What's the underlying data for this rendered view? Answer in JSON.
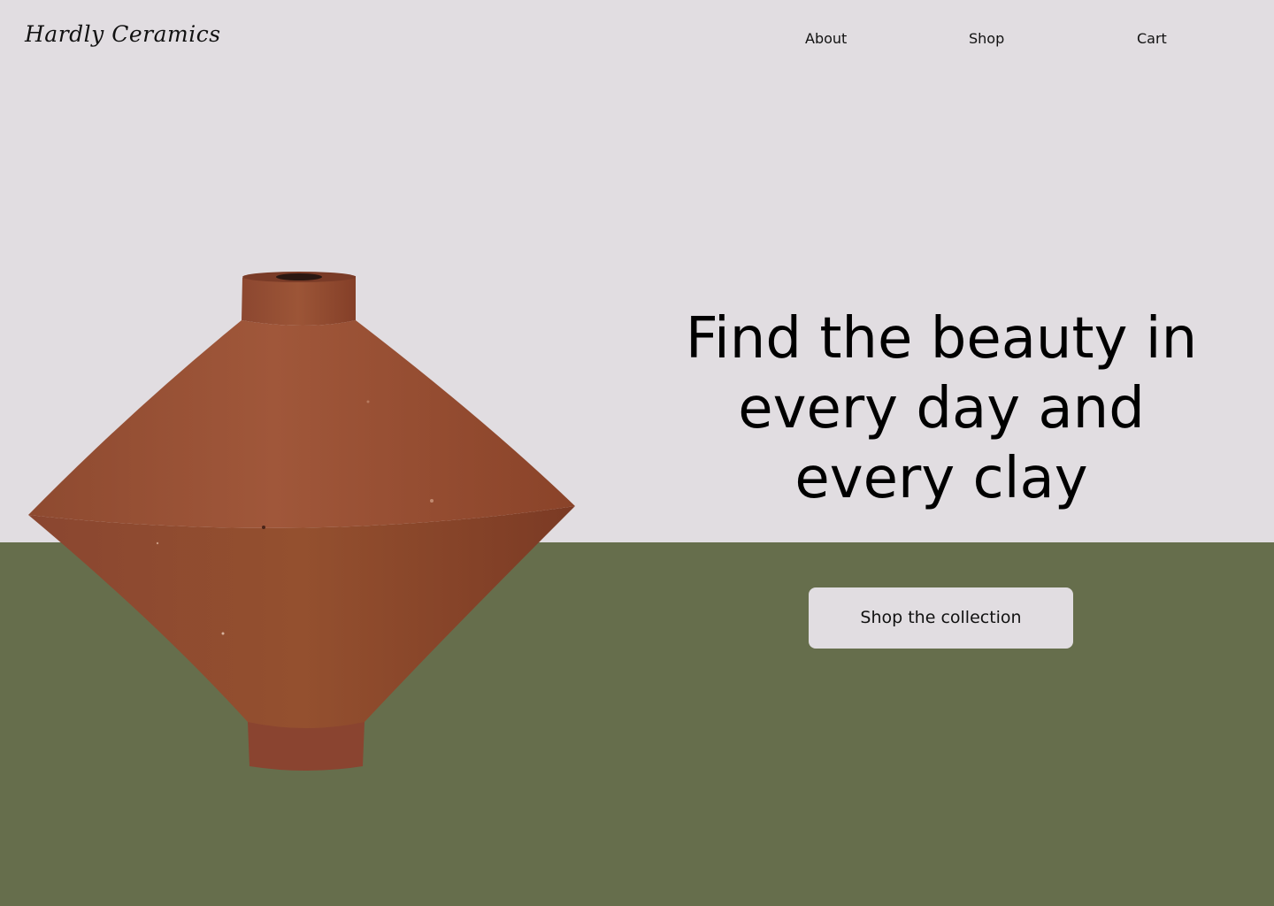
{
  "brand": {
    "logo_text": "Hardly Ceramics"
  },
  "nav": {
    "items": [
      {
        "label": "About"
      },
      {
        "label": "Shop"
      },
      {
        "label": "Cart"
      }
    ]
  },
  "hero": {
    "headline": "Find the beauty in every day and every clay",
    "cta_label": "Shop the collection",
    "image_subject": "terracotta-vase"
  },
  "colors": {
    "background_top": "#E1DDE1",
    "background_bottom": "#666E4C",
    "vase": "#9A4F32",
    "button_bg": "#E1DDE1",
    "text": "#000000"
  }
}
